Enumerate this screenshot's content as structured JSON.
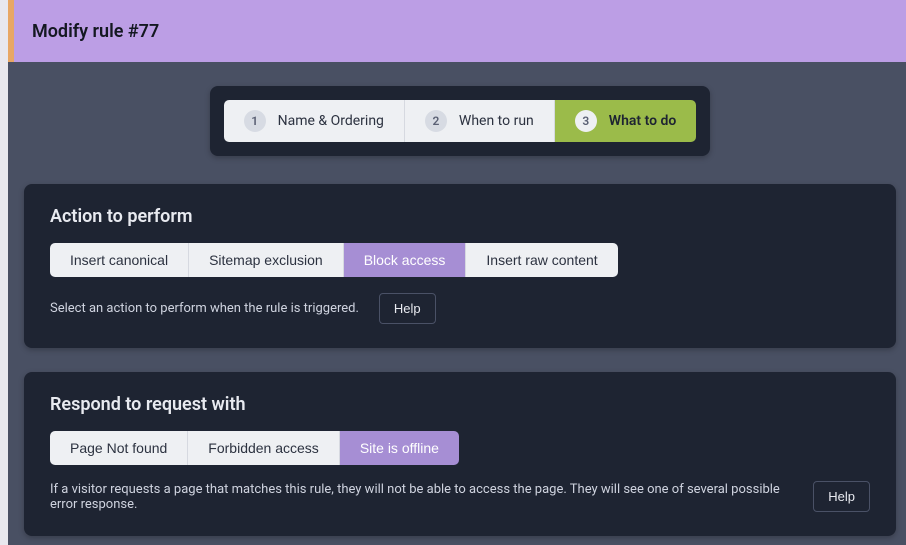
{
  "header": {
    "title": "Modify rule #77"
  },
  "stepper": {
    "steps": [
      {
        "num": "1",
        "label": "Name & Ordering",
        "active": false
      },
      {
        "num": "2",
        "label": "When to run",
        "active": false
      },
      {
        "num": "3",
        "label": "What to do",
        "active": true
      }
    ]
  },
  "panels": {
    "action": {
      "title": "Action to perform",
      "options": [
        {
          "label": "Insert canonical",
          "selected": false
        },
        {
          "label": "Sitemap exclusion",
          "selected": false
        },
        {
          "label": "Block access",
          "selected": true
        },
        {
          "label": "Insert raw content",
          "selected": false
        }
      ],
      "hint": "Select an action to perform when the rule is triggered.",
      "help": "Help"
    },
    "respond": {
      "title": "Respond to request with",
      "options": [
        {
          "label": "Page Not found",
          "selected": false
        },
        {
          "label": "Forbidden access",
          "selected": false
        },
        {
          "label": "Site is offline",
          "selected": true
        }
      ],
      "hint": "If a visitor requests a page that matches this rule, they will not be able to access the page. They will see one of several possible error response.",
      "help": "Help"
    }
  }
}
